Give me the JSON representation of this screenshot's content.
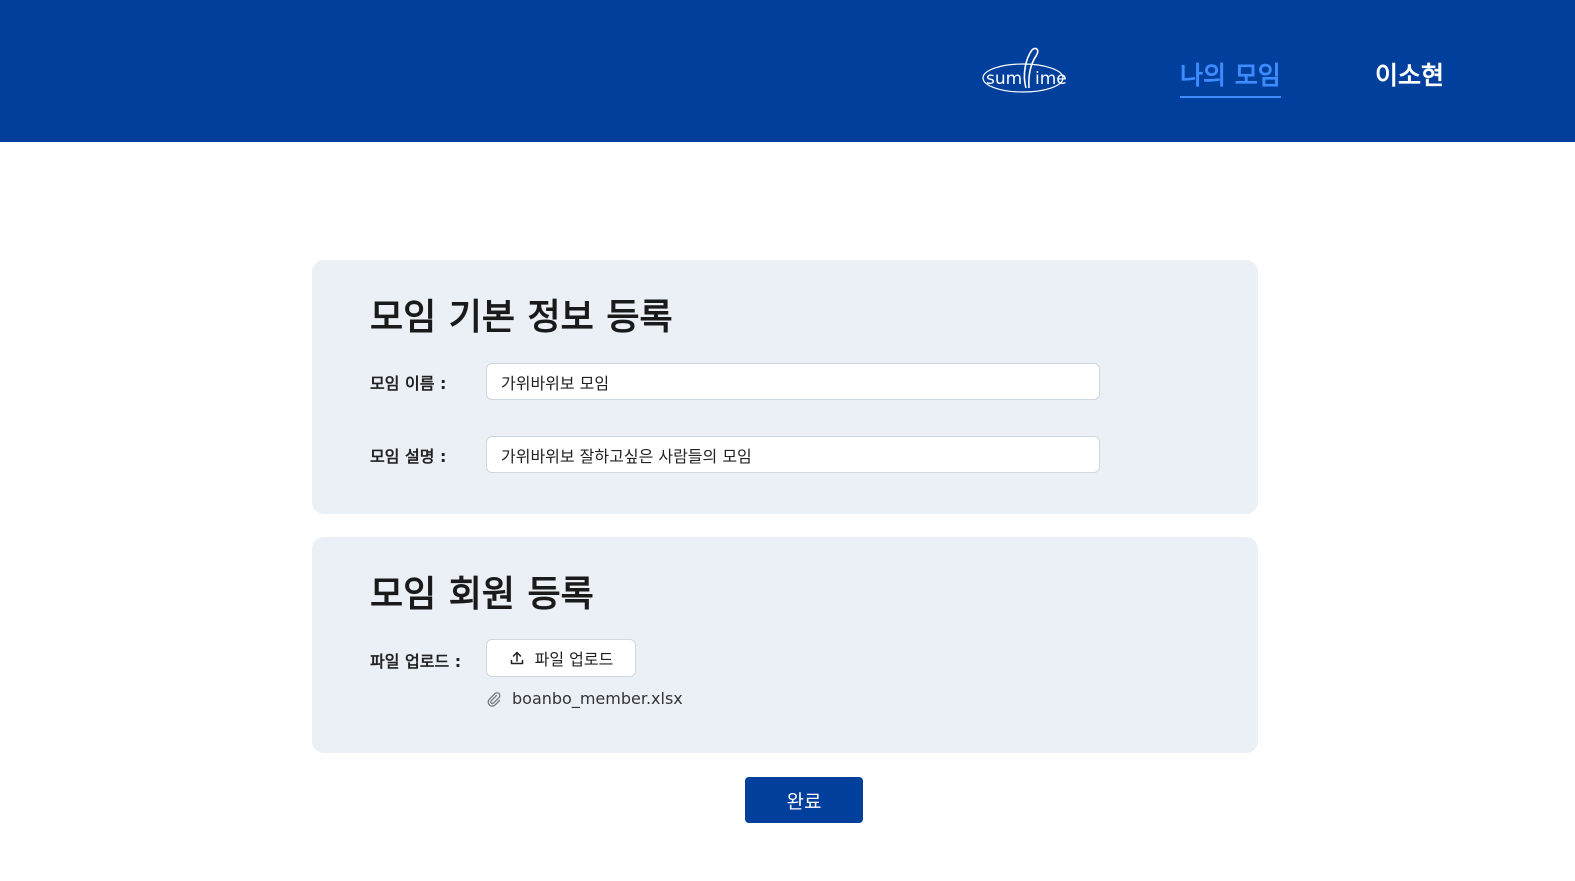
{
  "header": {
    "logo_text_left": "sum",
    "logo_text_right": "ime",
    "nav_my_groups": "나의 모임",
    "user_name": "이소현",
    "active_color": "#3d8bff",
    "bg_color": "#003f9b"
  },
  "basic_info": {
    "title": "모임 기본 정보 등록",
    "name_label": "모임 이름 :",
    "name_value": "가위바위보 모임",
    "desc_label": "모임 설명 :",
    "desc_value": "가위바위보 잘하고싶은 사람들의 모임"
  },
  "members": {
    "title": "모임 회원 등록",
    "upload_label": "파일 업로드 :",
    "upload_button": "파일 업로드",
    "upload_icon": "upload-icon",
    "file_icon": "paperclip-icon",
    "file_name": "boanbo_member.xlsx"
  },
  "actions": {
    "done_button": "완료"
  }
}
